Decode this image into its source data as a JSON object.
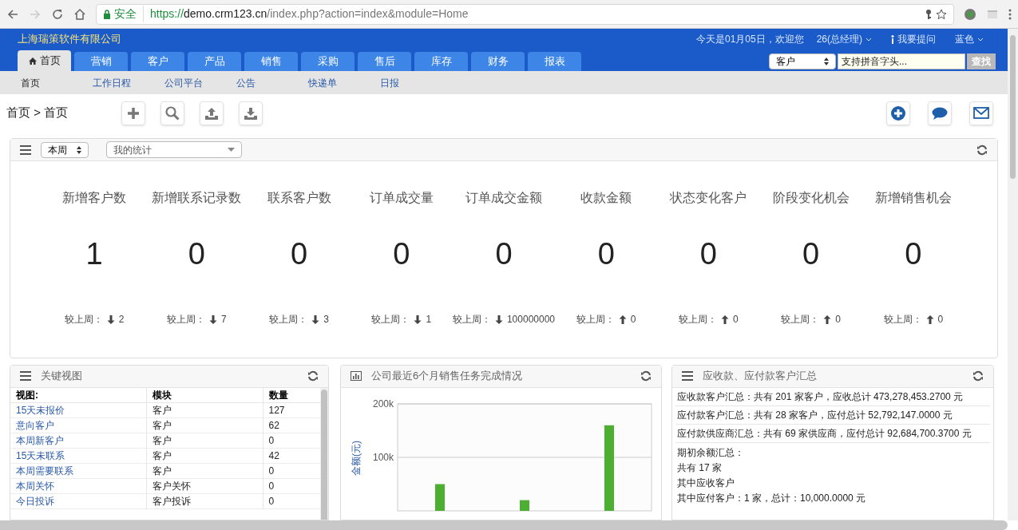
{
  "browser": {
    "secure_label": "安全",
    "url": {
      "scheme": "https://",
      "host": "demo.crm123.cn",
      "path": "/index.php?action=index&module=Home"
    }
  },
  "header": {
    "company": "上海瑞策软件有限公司",
    "greeting": "今天是01月05日，欢迎您",
    "user": "26(总经理)",
    "help": "我要提问",
    "theme": "蓝色"
  },
  "tabs": [
    {
      "label": "首页",
      "selected": true,
      "kind": "home"
    },
    {
      "label": "营销",
      "selected": false
    },
    {
      "label": "客户",
      "selected": false
    },
    {
      "label": "产品",
      "selected": false
    },
    {
      "label": "销售",
      "selected": false
    },
    {
      "label": "采购",
      "selected": false
    },
    {
      "label": "售后",
      "selected": false
    },
    {
      "label": "库存",
      "selected": false
    },
    {
      "label": "财务",
      "selected": false
    },
    {
      "label": "报表",
      "selected": false
    }
  ],
  "search": {
    "scope": "客户",
    "placeholder": "支持拼音字头...",
    "button": "查找"
  },
  "subnav": [
    {
      "label": "首页",
      "selected": true
    },
    {
      "label": "工作日程",
      "selected": false
    },
    {
      "label": "公司平台",
      "selected": false
    },
    {
      "label": "公告",
      "selected": false
    },
    {
      "label": "快递单",
      "selected": false
    },
    {
      "label": "日报",
      "selected": false
    }
  ],
  "breadcrumb": "首页 > 首页",
  "stats_panel": {
    "period": "本周",
    "view": "我的统计",
    "items": [
      {
        "label": "新增客户数",
        "value": "1",
        "compare_label": "较上周：",
        "kind": "down",
        "delta": "2"
      },
      {
        "label": "新增联系记录数",
        "value": "0",
        "compare_label": "较上周：",
        "kind": "down",
        "delta": "7"
      },
      {
        "label": "联系客户数",
        "value": "0",
        "compare_label": "较上周：",
        "kind": "down",
        "delta": "3"
      },
      {
        "label": "订单成交量",
        "value": "0",
        "compare_label": "较上周：",
        "kind": "down",
        "delta": "1"
      },
      {
        "label": "订单成交金额",
        "value": "0",
        "compare_label": "较上周：",
        "kind": "down",
        "delta": "100000000"
      },
      {
        "label": "收款金额",
        "value": "0",
        "compare_label": "较上周：",
        "kind": "up",
        "delta": "0"
      },
      {
        "label": "状态变化客户",
        "value": "0",
        "compare_label": "较上周：",
        "kind": "up",
        "delta": "0"
      },
      {
        "label": "阶段变化机会",
        "value": "0",
        "compare_label": "较上周：",
        "kind": "up",
        "delta": "0"
      },
      {
        "label": "新增销售机会",
        "value": "0",
        "compare_label": "较上周：",
        "kind": "up",
        "delta": "0"
      }
    ]
  },
  "key_views": {
    "title": "关键视图",
    "columns": [
      "视图:",
      "模块",
      "数量"
    ],
    "rows": [
      [
        "15天未报价",
        "客户",
        "127"
      ],
      [
        "意向客户",
        "客户",
        "62"
      ],
      [
        "本周新客户",
        "客户",
        "0"
      ],
      [
        "15天未联系",
        "客户",
        "42"
      ],
      [
        "本周需要联系",
        "客户",
        "0"
      ],
      [
        "本周关怀",
        "客户关怀",
        "0"
      ],
      [
        "今日投诉",
        "客户投诉",
        "0"
      ]
    ]
  },
  "sales_chart": {
    "title": "公司最近6个月销售任务完成情况",
    "chart_data": {
      "type": "bar",
      "ylabel": "金额(元)",
      "values": [
        50000,
        20000,
        160000
      ],
      "ylim": [
        0,
        200000
      ],
      "yticks": [
        {
          "value": 100000,
          "label": "100k"
        },
        {
          "value": 200000,
          "label": "200k"
        }
      ]
    }
  },
  "summary": {
    "title": "应收款、应付款客户汇总",
    "totals": [
      "应收款客户汇总：共有 201 家客户，应收总计 473,278,453.2700 元",
      "应付款客户汇总：共有 28 家客户，应付总计 52,792,147.0000 元",
      "应付款供应商汇总：共有 69 家供应商，应付总计 92,684,700.3700 元"
    ],
    "opening_balance": [
      "期初余额汇总：",
      "共有 17 家",
      "其中应收客户",
      "其中应付客户：1 家，总计：10,000.0000 元"
    ]
  }
}
